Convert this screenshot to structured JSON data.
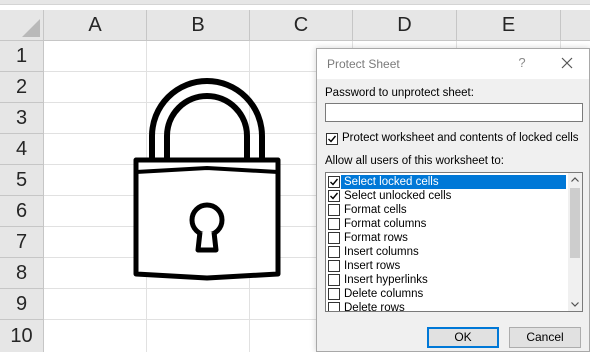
{
  "sheet": {
    "columns": [
      "A",
      "B",
      "C",
      "D",
      "E"
    ],
    "rows": [
      "1",
      "2",
      "3",
      "4",
      "5",
      "6",
      "7",
      "8",
      "9",
      "10"
    ],
    "image_icon": "padlock-icon"
  },
  "dialog": {
    "title": "Protect Sheet",
    "help_label": "?",
    "close_icon": "close-icon",
    "password_label": "Password to unprotect sheet:",
    "password_value": "",
    "protect_label": "Protect worksheet and contents of locked cells",
    "protect_checked": true,
    "allow_label": "Allow all users of this worksheet to:",
    "permissions": [
      {
        "label": "Select locked cells",
        "checked": true,
        "selected": true
      },
      {
        "label": "Select unlocked cells",
        "checked": true,
        "selected": false
      },
      {
        "label": "Format cells",
        "checked": false,
        "selected": false
      },
      {
        "label": "Format columns",
        "checked": false,
        "selected": false
      },
      {
        "label": "Format rows",
        "checked": false,
        "selected": false
      },
      {
        "label": "Insert columns",
        "checked": false,
        "selected": false
      },
      {
        "label": "Insert rows",
        "checked": false,
        "selected": false
      },
      {
        "label": "Insert hyperlinks",
        "checked": false,
        "selected": false
      },
      {
        "label": "Delete columns",
        "checked": false,
        "selected": false
      },
      {
        "label": "Delete rows",
        "checked": false,
        "selected": false
      }
    ],
    "ok_label": "OK",
    "cancel_label": "Cancel",
    "colors": {
      "selection": "#0078d7",
      "dialog_bg": "#f0f0f0",
      "header_bg": "#e6e6e6"
    }
  }
}
